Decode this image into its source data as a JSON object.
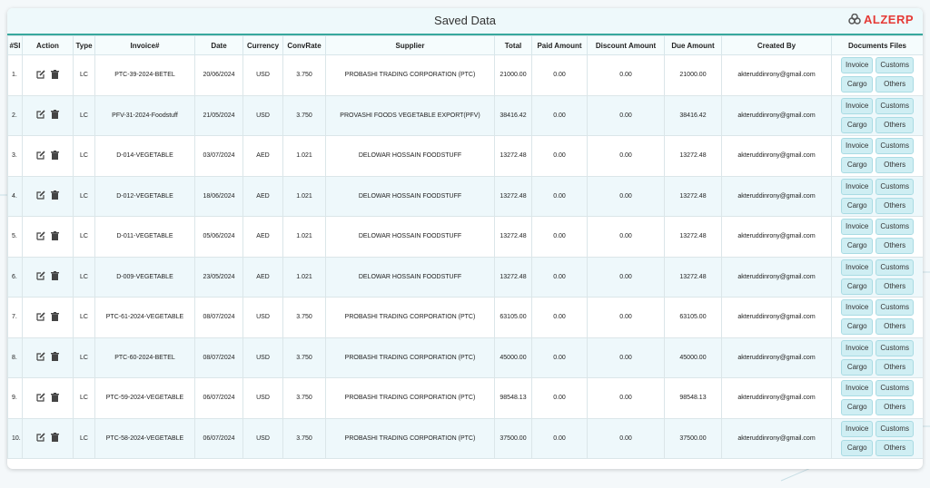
{
  "header": {
    "title": "Saved Data",
    "logo_text": "ALZERP"
  },
  "colors": {
    "accent": "#38a89d",
    "logo": "#e53935",
    "row_alt": "#eef8fb",
    "doc_button": "#cfeef3"
  },
  "columns": [
    "#Sl",
    "Action",
    "Type",
    "Invoice#",
    "Date",
    "Currency",
    "ConvRate",
    "Supplier",
    "Total",
    "Paid Amount",
    "Discount Amount",
    "Due Amount",
    "Created By",
    "Documents Files"
  ],
  "actions": {
    "edit_icon": "edit-icon",
    "delete_icon": "trash-icon"
  },
  "doc_buttons": [
    "Invoice",
    "Customs",
    "Cargo",
    "Others"
  ],
  "rows": [
    {
      "sl": "1.",
      "type": "LC",
      "invoice": "PTC-39-2024-BETEL",
      "date": "20/06/2024",
      "currency": "USD",
      "rate": "3.750",
      "supplier": "PROBASHI TRADING CORPORATION (PTC)",
      "total": "21000.00",
      "paid": "0.00",
      "discount": "0.00",
      "due": "21000.00",
      "created_by": "akteruddinrony@gmail.com"
    },
    {
      "sl": "2.",
      "type": "LC",
      "invoice": "PFV-31-2024-Foodstuff",
      "date": "21/05/2024",
      "currency": "USD",
      "rate": "3.750",
      "supplier": "PROVASHI FOODS VEGETABLE EXPORT(PFV)",
      "total": "38416.42",
      "paid": "0.00",
      "discount": "0.00",
      "due": "38416.42",
      "created_by": "akteruddinrony@gmail.com"
    },
    {
      "sl": "3.",
      "type": "LC",
      "invoice": "D-014-VEGETABLE",
      "date": "03/07/2024",
      "currency": "AED",
      "rate": "1.021",
      "supplier": "DELOWAR HOSSAIN FOODSTUFF",
      "total": "13272.48",
      "paid": "0.00",
      "discount": "0.00",
      "due": "13272.48",
      "created_by": "akteruddinrony@gmail.com"
    },
    {
      "sl": "4.",
      "type": "LC",
      "invoice": "D-012-VEGETABLE",
      "date": "18/06/2024",
      "currency": "AED",
      "rate": "1.021",
      "supplier": "DELOWAR HOSSAIN FOODSTUFF",
      "total": "13272.48",
      "paid": "0.00",
      "discount": "0.00",
      "due": "13272.48",
      "created_by": "akteruddinrony@gmail.com"
    },
    {
      "sl": "5.",
      "type": "LC",
      "invoice": "D-011-VEGETABLE",
      "date": "05/06/2024",
      "currency": "AED",
      "rate": "1.021",
      "supplier": "DELOWAR HOSSAIN FOODSTUFF",
      "total": "13272.48",
      "paid": "0.00",
      "discount": "0.00",
      "due": "13272.48",
      "created_by": "akteruddinrony@gmail.com"
    },
    {
      "sl": "6.",
      "type": "LC",
      "invoice": "D-009-VEGETABLE",
      "date": "23/05/2024",
      "currency": "AED",
      "rate": "1.021",
      "supplier": "DELOWAR HOSSAIN FOODSTUFF",
      "total": "13272.48",
      "paid": "0.00",
      "discount": "0.00",
      "due": "13272.48",
      "created_by": "akteruddinrony@gmail.com"
    },
    {
      "sl": "7.",
      "type": "LC",
      "invoice": "PTC-61-2024-VEGETABLE",
      "date": "08/07/2024",
      "currency": "USD",
      "rate": "3.750",
      "supplier": "PROBASHI TRADING CORPORATION (PTC)",
      "total": "63105.00",
      "paid": "0.00",
      "discount": "0.00",
      "due": "63105.00",
      "created_by": "akteruddinrony@gmail.com"
    },
    {
      "sl": "8.",
      "type": "LC",
      "invoice": "PTC-60-2024-BETEL",
      "date": "08/07/2024",
      "currency": "USD",
      "rate": "3.750",
      "supplier": "PROBASHI TRADING CORPORATION (PTC)",
      "total": "45000.00",
      "paid": "0.00",
      "discount": "0.00",
      "due": "45000.00",
      "created_by": "akteruddinrony@gmail.com"
    },
    {
      "sl": "9.",
      "type": "LC",
      "invoice": "PTC-59-2024-VEGETABLE",
      "date": "06/07/2024",
      "currency": "USD",
      "rate": "3.750",
      "supplier": "PROBASHI TRADING CORPORATION (PTC)",
      "total": "98548.13",
      "paid": "0.00",
      "discount": "0.00",
      "due": "98548.13",
      "created_by": "akteruddinrony@gmail.com"
    },
    {
      "sl": "10.",
      "type": "LC",
      "invoice": "PTC-58-2024-VEGETABLE",
      "date": "06/07/2024",
      "currency": "USD",
      "rate": "3.750",
      "supplier": "PROBASHI TRADING CORPORATION (PTC)",
      "total": "37500.00",
      "paid": "0.00",
      "discount": "0.00",
      "due": "37500.00",
      "created_by": "akteruddinrony@gmail.com"
    }
  ]
}
